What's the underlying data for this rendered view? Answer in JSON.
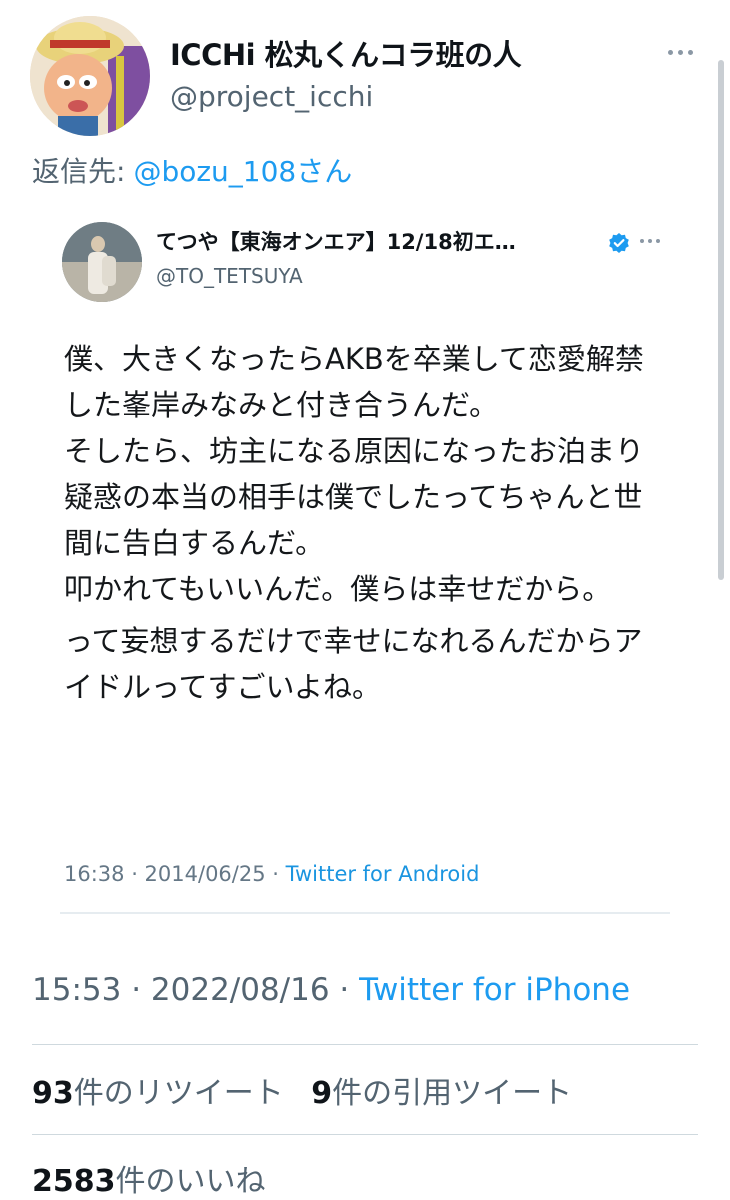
{
  "author": {
    "display_name": "ICCHi 松丸くんコラ班の人",
    "handle": "@project_icchi"
  },
  "reply_to": {
    "label": "返信先:",
    "mention": "@bozu_108さん"
  },
  "quoted_tweet": {
    "display_name": "てつや【東海オンエア】12/18初エ…",
    "handle": "@TO_TETSUYA",
    "paragraphs": [
      "僕、大きくなったらAKBを卒業して恋愛解禁した峯岸みなみと付き合うんだ。\nそしたら、坊主になる原因になったお泊まり疑惑の本当の相手は僕でしたってちゃんと世間に告白するんだ。\n叩かれてもいいんだ。僕らは幸せだから。",
      "って妄想するだけで幸せになれるんだからアイドルってすごいよね。"
    ],
    "timestamp": "16:38 · 2014/06/25 · ",
    "client": "Twitter for Android"
  },
  "tweet_meta": {
    "timestamp": "15:53 · 2022/08/16 · ",
    "client": "Twitter for iPhone"
  },
  "stats": {
    "retweets_count": "93",
    "retweets_label": "件のリツイート",
    "quotes_count": "9",
    "quotes_label": "件の引用ツイート",
    "likes_count": "2583",
    "likes_label": "件のいいね"
  },
  "colors": {
    "link": "#1d9bf0",
    "secondary_text": "#536471",
    "verified": "#1d9bf0"
  },
  "icons": {
    "more": "more-dots-icon",
    "verified": "verified-badge-icon"
  }
}
